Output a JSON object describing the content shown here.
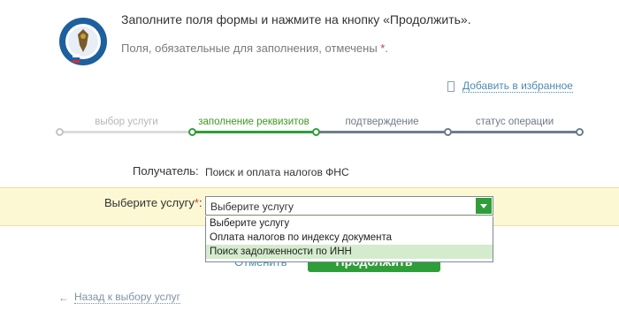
{
  "header": {
    "logo_icon": "fns-emblem-icon",
    "intro_text": "Заполните поля формы и нажмите на кнопку «Продолжить».",
    "hint_text": "Поля, обязательные для заполнения, отмечены",
    "required_mark": "*",
    "hint_end": "."
  },
  "favorites": {
    "icon": "bookmark-icon",
    "label": "Добавить в избранное"
  },
  "steps": [
    {
      "label": "выбор услуги",
      "state": "done"
    },
    {
      "label": "заполнение реквизитов",
      "state": "active"
    },
    {
      "label": "подтверждение",
      "state": "todo"
    },
    {
      "label": "статус операции",
      "state": "todo"
    }
  ],
  "form": {
    "recipient_label": "Получатель:",
    "recipient_value": "Поиск и оплата налогов ФНС",
    "service_label": "Выберите услугу",
    "service_required_mark": "*",
    "service_colon": ":",
    "service_selected": "Выберите услугу",
    "service_options": [
      "Выберите услугу",
      "Оплата налогов по индексу документа",
      "Поиск задолженности по ИНН"
    ],
    "highlighted_option": 2
  },
  "actions": {
    "cancel_label": "Отменить",
    "submit_label": "Продолжить"
  },
  "back": {
    "icon": "arrow-left-icon",
    "label": "Назад к выбору услуг"
  },
  "colors": {
    "accent_green": "#2f9e38",
    "link_blue": "#4e8bb3",
    "highlight_band": "#fdf8d4"
  }
}
